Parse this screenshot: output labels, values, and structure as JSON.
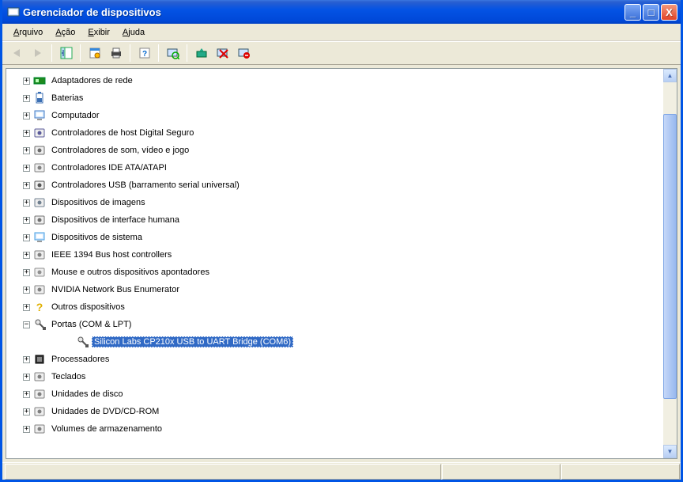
{
  "window": {
    "title": "Gerenciador de dispositivos"
  },
  "titlebar_buttons": {
    "minimize": "_",
    "maximize": "□",
    "close": "X"
  },
  "menu": {
    "arquivo": "rquivo",
    "arquivo_u": "A",
    "acao": "ção",
    "acao_u": "A",
    "exibir": "xibir",
    "exibir_u": "E",
    "ajuda": "juda",
    "ajuda_u": "A"
  },
  "tree": {
    "items": [
      {
        "label": "Adaptadores de rede",
        "icon": "network-adapter-icon",
        "exp": "+"
      },
      {
        "label": "Baterias",
        "icon": "battery-icon",
        "exp": "+"
      },
      {
        "label": "Computador",
        "icon": "computer-icon",
        "exp": "+"
      },
      {
        "label": "Controladores de host Digital Seguro",
        "icon": "sd-host-icon",
        "exp": "+"
      },
      {
        "label": "Controladores de som, vídeo e jogo",
        "icon": "sound-icon",
        "exp": "+"
      },
      {
        "label": "Controladores IDE ATA/ATAPI",
        "icon": "ide-icon",
        "exp": "+"
      },
      {
        "label": "Controladores USB (barramento serial universal)",
        "icon": "usb-icon",
        "exp": "+"
      },
      {
        "label": "Dispositivos de imagens",
        "icon": "imaging-icon",
        "exp": "+"
      },
      {
        "label": "Dispositivos de interface humana",
        "icon": "hid-icon",
        "exp": "+"
      },
      {
        "label": "Dispositivos de sistema",
        "icon": "system-device-icon",
        "exp": "+"
      },
      {
        "label": "IEEE 1394 Bus host controllers",
        "icon": "ieee1394-icon",
        "exp": "+"
      },
      {
        "label": "Mouse e outros dispositivos apontadores",
        "icon": "mouse-icon",
        "exp": "+"
      },
      {
        "label": "NVIDIA Network Bus Enumerator",
        "icon": "nvidia-icon",
        "exp": "+"
      },
      {
        "label": "Outros dispositivos",
        "icon": "unknown-device-icon",
        "exp": "+"
      },
      {
        "label": "Portas (COM & LPT)",
        "icon": "ports-icon",
        "exp": "−"
      },
      {
        "label": "Processadores",
        "icon": "processor-icon",
        "exp": "+"
      },
      {
        "label": "Teclados",
        "icon": "keyboard-icon",
        "exp": "+"
      },
      {
        "label": "Unidades de disco",
        "icon": "disk-icon",
        "exp": "+"
      },
      {
        "label": "Unidades de DVD/CD-ROM",
        "icon": "dvd-icon",
        "exp": "+"
      },
      {
        "label": "Volumes de armazenamento",
        "icon": "storage-volume-icon",
        "exp": "+"
      }
    ],
    "ports_child": {
      "label": "Silicon Labs CP210x USB to UART Bridge (COM6)",
      "icon": "port-icon"
    }
  },
  "icons": {
    "network-adapter-icon": "#1e8a1e",
    "battery-icon": "#3b6fb3",
    "computer-icon": "#4a7dc3",
    "sd-host-icon": "#5a5a9a",
    "sound-icon": "#6a6a6a",
    "ide-icon": "#808080",
    "usb-icon": "#555555",
    "imaging-icon": "#708090",
    "hid-icon": "#707070",
    "system-device-icon": "#4aa0e0",
    "ieee1394-icon": "#808080",
    "mouse-icon": "#909090",
    "nvidia-icon": "#808080",
    "unknown-device-icon": "#e0b000",
    "ports-icon": "#606060",
    "port-icon": "#606060",
    "processor-icon": "#404040",
    "keyboard-icon": "#808080",
    "disk-icon": "#808080",
    "dvd-icon": "#808080",
    "storage-volume-icon": "#808080"
  }
}
